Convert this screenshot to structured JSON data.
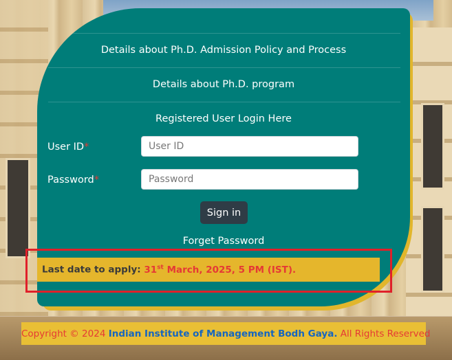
{
  "links": {
    "admission_policy": "Details about Ph.D. Admission Policy and Process",
    "phd_program": "Details about Ph.D. program"
  },
  "login": {
    "heading": "Registered User Login Here",
    "user_id_label": "User ID",
    "user_id_placeholder": "User ID",
    "password_label": "Password",
    "password_placeholder": "Password",
    "required_mark": "*",
    "sign_in_label": "Sign in",
    "forget_password_label": "Forget Password"
  },
  "notice": {
    "prefix": "Last date to apply:",
    "day": "31",
    "day_suffix": "st",
    "date_rest": "March, 2025, 5 PM (IST)."
  },
  "footer": {
    "copyright": "Copyright © 2024",
    "org": "Indian Institute of Management Bodh Gaya.",
    "rights": "All Rights Reserved"
  },
  "colors": {
    "card": "#007d79",
    "accent_gold": "#e5b62c",
    "required_red": "#e53935",
    "sign_in_button": "#2f3c46",
    "footer_org_blue": "#1565c0",
    "highlight_border": "#e0202a"
  }
}
